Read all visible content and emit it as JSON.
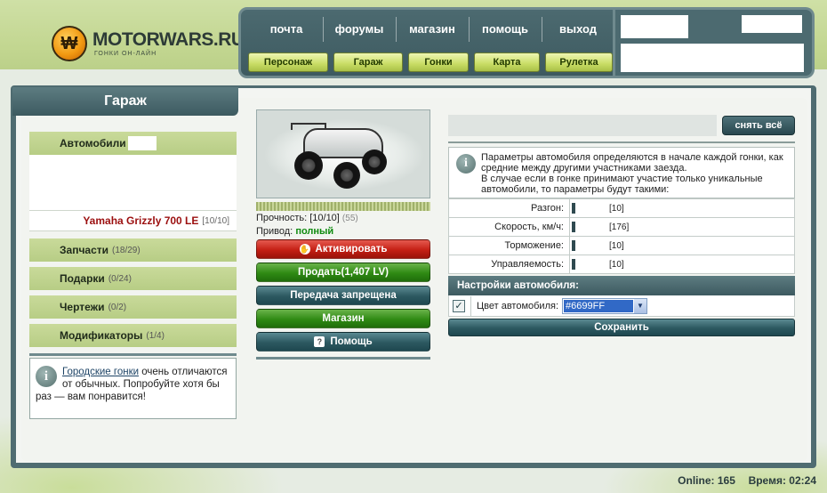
{
  "logo": {
    "text": "MOTORWARS.RU",
    "subtitle": "ГОНКИ ОН-ЛАЙН",
    "mark": "₩"
  },
  "nav": {
    "links": [
      "почта",
      "форумы",
      "магазин",
      "помощь",
      "выход"
    ],
    "buttons": [
      "Персонаж",
      "Гараж",
      "Гонки",
      "Карта",
      "Рулетка"
    ]
  },
  "page_title": "Гараж",
  "left": {
    "categories": {
      "auto": {
        "label": "Автомобили"
      },
      "parts": {
        "label": "Запчасти",
        "count": "(18/29)"
      },
      "gifts": {
        "label": "Подарки",
        "count": "(0/24)"
      },
      "blueprints": {
        "label": "Чертежи",
        "count": "(0/2)"
      },
      "mods": {
        "label": "Модификаторы",
        "count": "(1/4)"
      }
    },
    "selected_car": {
      "name": "Yamaha Grizzly 700 LE",
      "durability": "[10/10]"
    },
    "tip": {
      "link": "Городские гонки",
      "text": " очень отличаются от обычных. Попробуйте хотя бы раз — вам понравится!"
    }
  },
  "middle": {
    "durability_label": "Прочность:",
    "durability_value": "[10/10]",
    "durability_extra": "(55)",
    "drive_label": "Привод:",
    "drive_value": "полный",
    "buttons": {
      "activate": "Активировать",
      "sell": "Продать(1,407 LV)",
      "transfer": "Передача запрещена",
      "shop": "Магазин",
      "help": "Помощь"
    }
  },
  "right": {
    "unequip_all": "снять всё",
    "info_line1": "Параметры автомобиля определяются в начале каждой гонки, как средние между другими участниками заезда.",
    "info_line2": "В случае если в гонке принимают участие только уникальные автомобили, то параметры будут такими:",
    "params": [
      {
        "label": "Разгон:",
        "value": "[10]"
      },
      {
        "label": "Скорость, км/ч:",
        "value": "[176]"
      },
      {
        "label": "Торможение:",
        "value": "[10]"
      },
      {
        "label": "Управляемость:",
        "value": "[10]"
      }
    ],
    "settings_title": "Настройки автомобиля:",
    "color_label": "Цвет автомобиля:",
    "color_value": "#6699FF",
    "save": "Сохранить"
  },
  "footer": {
    "online_label": "Online:",
    "online_value": "165",
    "time_label": "Время:",
    "time_value": "02:24"
  },
  "colors": {
    "accent_teal": "#3d5a60",
    "accent_green": "#b7cd85",
    "car_name": "#9b0f0f",
    "drive_ok": "#0e8a0e"
  },
  "icons": {
    "logo": "logo-coin-icon",
    "info": "info-icon",
    "hand": "hand-icon",
    "help": "question-icon",
    "checkbox": "check-icon",
    "dropdown": "chevron-down-icon"
  }
}
